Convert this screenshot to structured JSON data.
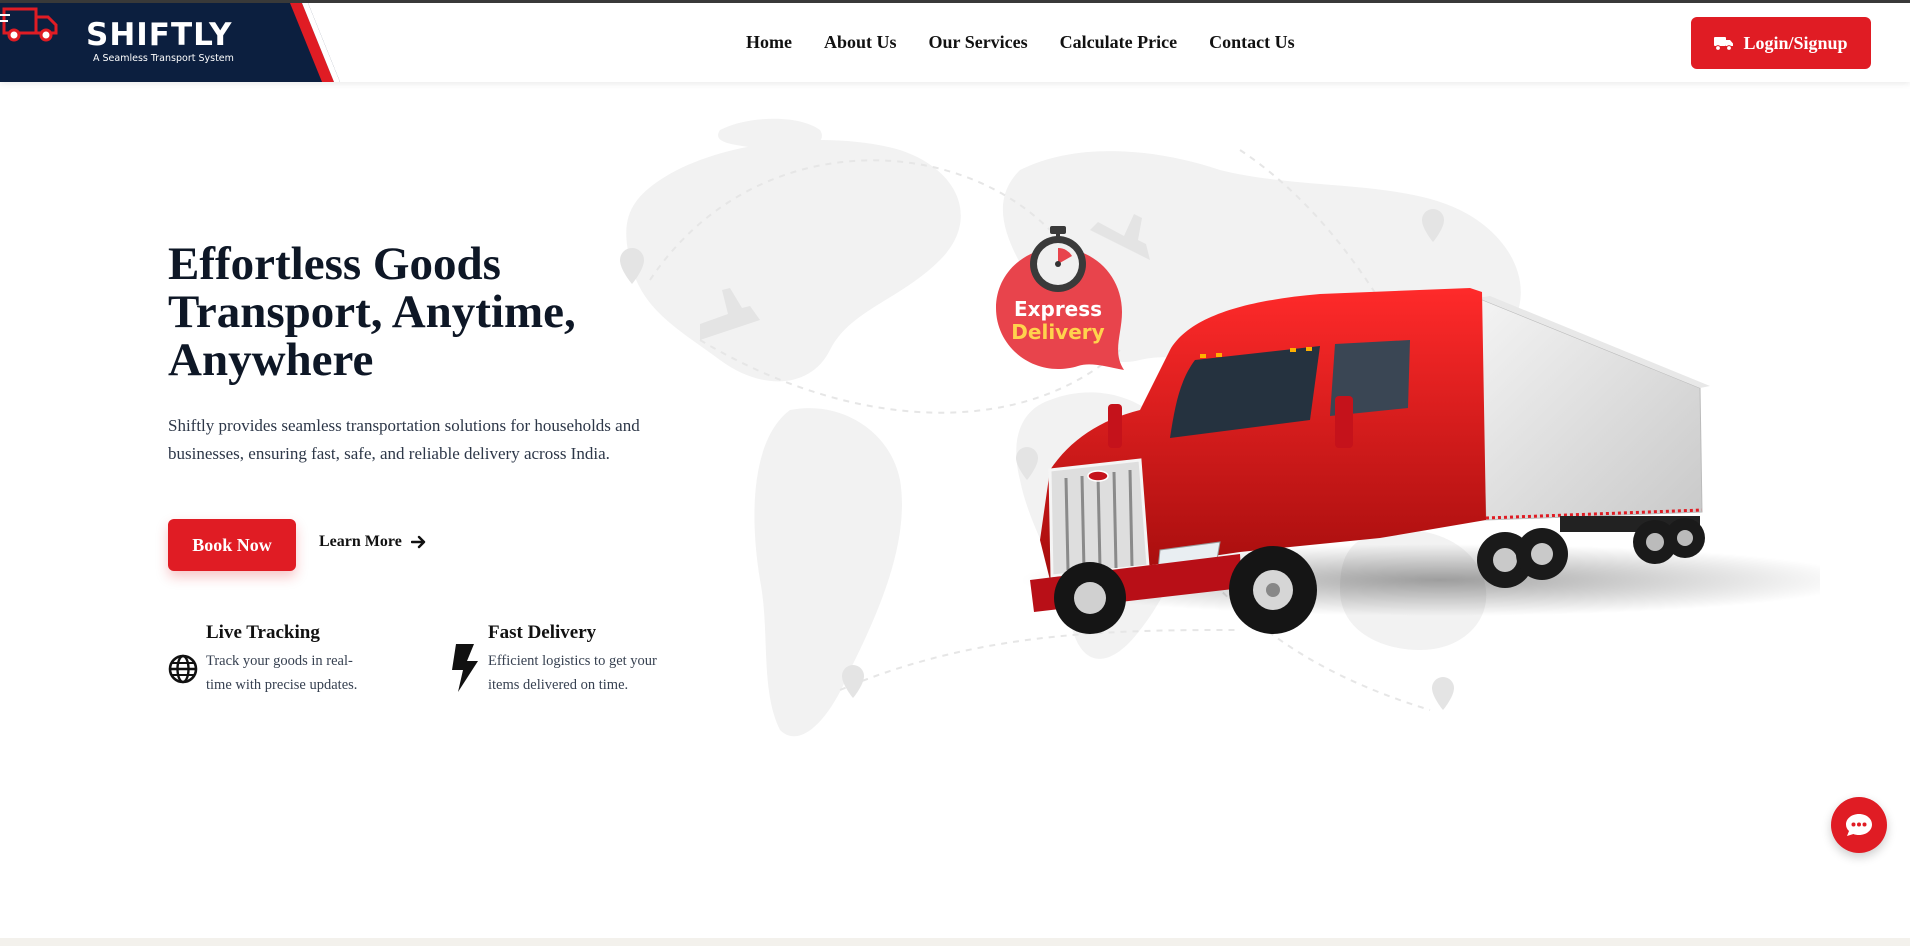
{
  "brand": {
    "name": "SHIFTLY",
    "tagline": "A Seamless Transport System",
    "colors": {
      "navy": "#0c1f3f",
      "accent": "#e01c24"
    }
  },
  "nav": {
    "items": [
      {
        "label": "Home"
      },
      {
        "label": "About Us"
      },
      {
        "label": "Our Services"
      },
      {
        "label": "Calculate Price"
      },
      {
        "label": "Contact Us"
      }
    ],
    "login_label": "Login/Signup",
    "login_icon": "truck-icon"
  },
  "hero": {
    "title": "Effortless Goods Transport, Anytime, Anywhere",
    "description": "Shiftly provides seamless transportation solutions for households and businesses, ensuring fast, safe, and reliable delivery across India.",
    "book_label": "Book Now",
    "learn_label": "Learn More",
    "learn_icon": "arrow-right-icon",
    "badge": {
      "line1": "Express",
      "line2": "Delivery",
      "icon": "stopwatch-icon"
    },
    "features": [
      {
        "icon": "globe-icon",
        "title": "Live Tracking",
        "description": "Track your goods in real-time with precise updates."
      },
      {
        "icon": "bolt-icon",
        "title": "Fast Delivery",
        "description": "Efficient logistics to get your items delivered on time."
      }
    ]
  },
  "chat": {
    "icon": "chat-bubble-icon"
  }
}
